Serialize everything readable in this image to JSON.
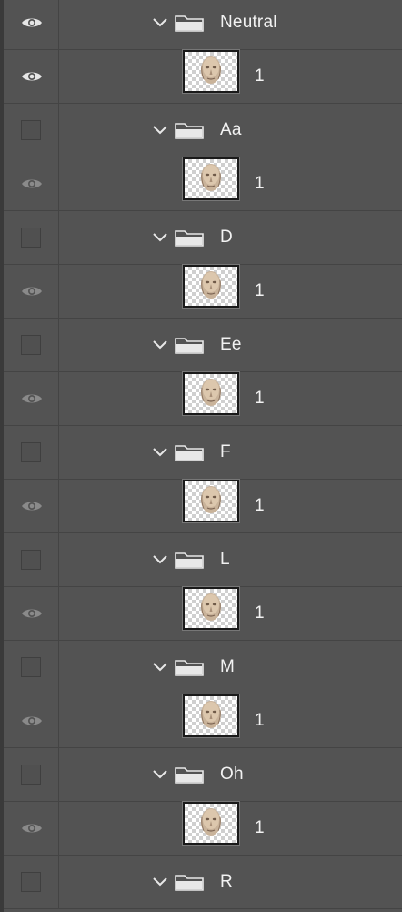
{
  "panel": "layers",
  "colors": {
    "background": "#535353",
    "divider": "#444444",
    "text": "#f2f2f2",
    "eye_on": "#e6e6e6",
    "eye_off": "#8a8a8a"
  },
  "rows": [
    {
      "type": "group",
      "name": "Neutral",
      "visibility": "visible",
      "expanded": true
    },
    {
      "type": "layer",
      "name": "1",
      "visibility": "visible"
    },
    {
      "type": "group",
      "name": "Aa",
      "visibility": "hidden",
      "expanded": true
    },
    {
      "type": "layer",
      "name": "1",
      "visibility": "dimmed"
    },
    {
      "type": "group",
      "name": "D",
      "visibility": "hidden",
      "expanded": true
    },
    {
      "type": "layer",
      "name": "1",
      "visibility": "dimmed"
    },
    {
      "type": "group",
      "name": "Ee",
      "visibility": "hidden",
      "expanded": true
    },
    {
      "type": "layer",
      "name": "1",
      "visibility": "dimmed"
    },
    {
      "type": "group",
      "name": "F",
      "visibility": "hidden",
      "expanded": true
    },
    {
      "type": "layer",
      "name": "1",
      "visibility": "dimmed"
    },
    {
      "type": "group",
      "name": "L",
      "visibility": "hidden",
      "expanded": true
    },
    {
      "type": "layer",
      "name": "1",
      "visibility": "dimmed"
    },
    {
      "type": "group",
      "name": "M",
      "visibility": "hidden",
      "expanded": true
    },
    {
      "type": "layer",
      "name": "1",
      "visibility": "dimmed"
    },
    {
      "type": "group",
      "name": "Oh",
      "visibility": "hidden",
      "expanded": true
    },
    {
      "type": "layer",
      "name": "1",
      "visibility": "dimmed"
    },
    {
      "type": "group",
      "name": "R",
      "visibility": "hidden",
      "expanded": true
    }
  ]
}
